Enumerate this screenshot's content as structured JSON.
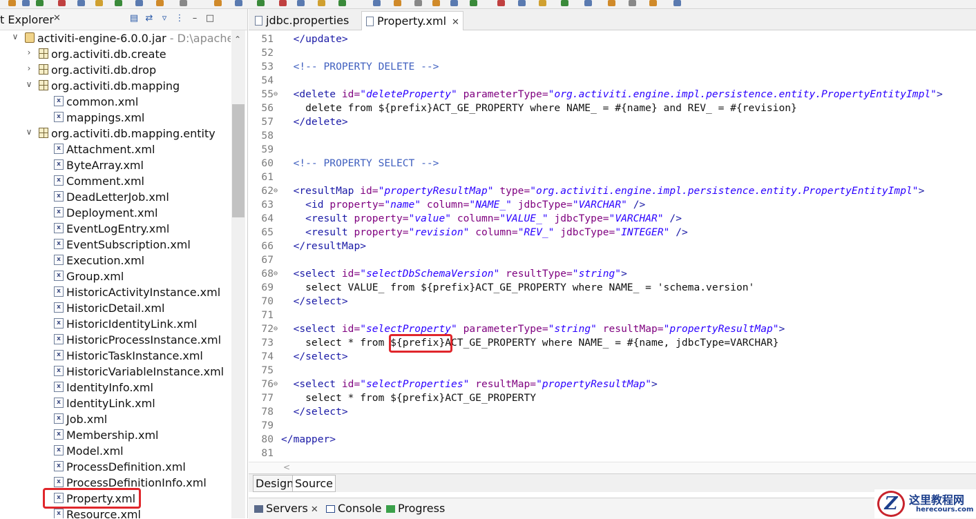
{
  "explorer": {
    "title": "t Explorer",
    "close": "✕",
    "toolbar_icons": [
      "collapse-all-icon",
      "link-editor-icon",
      "filter-icon",
      "view-menu-icon",
      "minimize-icon",
      "maximize-icon"
    ],
    "tree": [
      {
        "label": "activiti-engine-6.0.0.jar",
        "path": "- D:\\apache-ma",
        "type": "jar",
        "arrow": "∨",
        "indent": 0
      },
      {
        "label": "org.activiti.db.create",
        "type": "package",
        "arrow": "›",
        "indent": 1
      },
      {
        "label": "org.activiti.db.drop",
        "type": "package",
        "arrow": "›",
        "indent": 1
      },
      {
        "label": "org.activiti.db.mapping",
        "type": "package",
        "arrow": "∨",
        "indent": 1
      },
      {
        "label": "common.xml",
        "type": "xml",
        "indent": 2
      },
      {
        "label": "mappings.xml",
        "type": "xml",
        "indent": 2
      },
      {
        "label": "org.activiti.db.mapping.entity",
        "type": "package",
        "arrow": "∨",
        "indent": 1
      },
      {
        "label": "Attachment.xml",
        "type": "xml",
        "indent": 2
      },
      {
        "label": "ByteArray.xml",
        "type": "xml",
        "indent": 2
      },
      {
        "label": "Comment.xml",
        "type": "xml",
        "indent": 2
      },
      {
        "label": "DeadLetterJob.xml",
        "type": "xml",
        "indent": 2
      },
      {
        "label": "Deployment.xml",
        "type": "xml",
        "indent": 2
      },
      {
        "label": "EventLogEntry.xml",
        "type": "xml",
        "indent": 2
      },
      {
        "label": "EventSubscription.xml",
        "type": "xml",
        "indent": 2
      },
      {
        "label": "Execution.xml",
        "type": "xml",
        "indent": 2
      },
      {
        "label": "Group.xml",
        "type": "xml",
        "indent": 2
      },
      {
        "label": "HistoricActivityInstance.xml",
        "type": "xml",
        "indent": 2
      },
      {
        "label": "HistoricDetail.xml",
        "type": "xml",
        "indent": 2
      },
      {
        "label": "HistoricIdentityLink.xml",
        "type": "xml",
        "indent": 2
      },
      {
        "label": "HistoricProcessInstance.xml",
        "type": "xml",
        "indent": 2
      },
      {
        "label": "HistoricTaskInstance.xml",
        "type": "xml",
        "indent": 2
      },
      {
        "label": "HistoricVariableInstance.xml",
        "type": "xml",
        "indent": 2
      },
      {
        "label": "IdentityInfo.xml",
        "type": "xml",
        "indent": 2
      },
      {
        "label": "IdentityLink.xml",
        "type": "xml",
        "indent": 2
      },
      {
        "label": "Job.xml",
        "type": "xml",
        "indent": 2
      },
      {
        "label": "Membership.xml",
        "type": "xml",
        "indent": 2
      },
      {
        "label": "Model.xml",
        "type": "xml",
        "indent": 2
      },
      {
        "label": "ProcessDefinition.xml",
        "type": "xml",
        "indent": 2
      },
      {
        "label": "ProcessDefinitionInfo.xml",
        "type": "xml",
        "indent": 2
      },
      {
        "label": "Property.xml",
        "type": "xml",
        "indent": 2,
        "highlighted": true
      },
      {
        "label": "Resource.xml",
        "type": "xml",
        "indent": 2
      }
    ]
  },
  "editor": {
    "tabs": [
      {
        "label": "jdbc.properties",
        "active": false
      },
      {
        "label": "Property.xml",
        "active": true,
        "close": "✕"
      }
    ],
    "lines": [
      {
        "n": "51",
        "parts": [
          [
            "t",
            "  "
          ],
          [
            "tag",
            "</update>"
          ]
        ]
      },
      {
        "n": "52",
        "parts": []
      },
      {
        "n": "53",
        "parts": [
          [
            "t",
            "  "
          ],
          [
            "com",
            "<!-- PROPERTY DELETE -->"
          ]
        ]
      },
      {
        "n": "54",
        "parts": []
      },
      {
        "n": "55",
        "fold": true,
        "parts": [
          [
            "t",
            "  "
          ],
          [
            "tag",
            "<delete "
          ],
          [
            "attr",
            "id="
          ],
          [
            "val",
            "\"deleteProperty\""
          ],
          [
            "t",
            " "
          ],
          [
            "attr",
            "parameterType="
          ],
          [
            "val",
            "\"org.activiti.engine.impl.persistence.entity.PropertyEntityImpl\""
          ],
          [
            "tag",
            ">"
          ]
        ]
      },
      {
        "n": "56",
        "parts": [
          [
            "t",
            "    delete from ${prefix}ACT_GE_PROPERTY where NAME_ = #{name} and REV_ = #{revision}"
          ]
        ]
      },
      {
        "n": "57",
        "parts": [
          [
            "t",
            "  "
          ],
          [
            "tag",
            "</delete>"
          ]
        ]
      },
      {
        "n": "58",
        "parts": []
      },
      {
        "n": "59",
        "parts": []
      },
      {
        "n": "60",
        "parts": [
          [
            "t",
            "  "
          ],
          [
            "com",
            "<!-- PROPERTY SELECT -->"
          ]
        ]
      },
      {
        "n": "61",
        "parts": []
      },
      {
        "n": "62",
        "fold": true,
        "parts": [
          [
            "t",
            "  "
          ],
          [
            "tag",
            "<resultMap "
          ],
          [
            "attr",
            "id="
          ],
          [
            "val",
            "\"propertyResultMap\""
          ],
          [
            "t",
            " "
          ],
          [
            "attr",
            "type="
          ],
          [
            "val",
            "\"org.activiti.engine.impl.persistence.entity.PropertyEntityImpl\""
          ],
          [
            "tag",
            ">"
          ]
        ]
      },
      {
        "n": "63",
        "parts": [
          [
            "t",
            "    "
          ],
          [
            "tag",
            "<id "
          ],
          [
            "attr",
            "property="
          ],
          [
            "val",
            "\"name\""
          ],
          [
            "t",
            " "
          ],
          [
            "attr",
            "column="
          ],
          [
            "val",
            "\"NAME_\""
          ],
          [
            "t",
            " "
          ],
          [
            "attr",
            "jdbcType="
          ],
          [
            "val",
            "\"VARCHAR\""
          ],
          [
            "t",
            " "
          ],
          [
            "tag",
            "/>"
          ]
        ]
      },
      {
        "n": "64",
        "parts": [
          [
            "t",
            "    "
          ],
          [
            "tag",
            "<result "
          ],
          [
            "attr",
            "property="
          ],
          [
            "val",
            "\"value\""
          ],
          [
            "t",
            " "
          ],
          [
            "attr",
            "column="
          ],
          [
            "val",
            "\"VALUE_\""
          ],
          [
            "t",
            " "
          ],
          [
            "attr",
            "jdbcType="
          ],
          [
            "val",
            "\"VARCHAR\""
          ],
          [
            "t",
            " "
          ],
          [
            "tag",
            "/>"
          ]
        ]
      },
      {
        "n": "65",
        "parts": [
          [
            "t",
            "    "
          ],
          [
            "tag",
            "<result "
          ],
          [
            "attr",
            "property="
          ],
          [
            "val",
            "\"revision\""
          ],
          [
            "t",
            " "
          ],
          [
            "attr",
            "column="
          ],
          [
            "val",
            "\"REV_\""
          ],
          [
            "t",
            " "
          ],
          [
            "attr",
            "jdbcType="
          ],
          [
            "val",
            "\"INTEGER\""
          ],
          [
            "t",
            " "
          ],
          [
            "tag",
            "/>"
          ]
        ]
      },
      {
        "n": "66",
        "parts": [
          [
            "t",
            "  "
          ],
          [
            "tag",
            "</resultMap>"
          ]
        ]
      },
      {
        "n": "67",
        "parts": []
      },
      {
        "n": "68",
        "fold": true,
        "parts": [
          [
            "t",
            "  "
          ],
          [
            "tag",
            "<select "
          ],
          [
            "attr",
            "id="
          ],
          [
            "val",
            "\"selectDbSchemaVersion\""
          ],
          [
            "t",
            " "
          ],
          [
            "attr",
            "resultType="
          ],
          [
            "val",
            "\"string\""
          ],
          [
            "tag",
            ">"
          ]
        ]
      },
      {
        "n": "69",
        "parts": [
          [
            "t",
            "    select VALUE_ from ${prefix}ACT_GE_PROPERTY where NAME_ = 'schema.version'"
          ]
        ]
      },
      {
        "n": "70",
        "parts": [
          [
            "t",
            "  "
          ],
          [
            "tag",
            "</select>"
          ]
        ]
      },
      {
        "n": "71",
        "parts": []
      },
      {
        "n": "72",
        "fold": true,
        "parts": [
          [
            "t",
            "  "
          ],
          [
            "tag",
            "<select "
          ],
          [
            "attr",
            "id="
          ],
          [
            "val",
            "\"selectProperty\""
          ],
          [
            "t",
            " "
          ],
          [
            "attr",
            "parameterType="
          ],
          [
            "val",
            "\"string\""
          ],
          [
            "t",
            " "
          ],
          [
            "attr",
            "resultMap="
          ],
          [
            "val",
            "\"propertyResultMap\""
          ],
          [
            "tag",
            ">"
          ]
        ]
      },
      {
        "n": "73",
        "parts": [
          [
            "t",
            "    select * from ${prefix}ACT_GE_PROPERTY where NAME_ = #{name, jdbcType=VARCHAR}"
          ]
        ]
      },
      {
        "n": "74",
        "parts": [
          [
            "t",
            "  "
          ],
          [
            "tag",
            "</select>"
          ]
        ]
      },
      {
        "n": "75",
        "parts": []
      },
      {
        "n": "76",
        "fold": true,
        "parts": [
          [
            "t",
            "  "
          ],
          [
            "tag",
            "<select "
          ],
          [
            "attr",
            "id="
          ],
          [
            "val",
            "\"selectProperties\""
          ],
          [
            "t",
            " "
          ],
          [
            "attr",
            "resultMap="
          ],
          [
            "val",
            "\"propertyResultMap\""
          ],
          [
            "tag",
            ">"
          ]
        ]
      },
      {
        "n": "77",
        "parts": [
          [
            "t",
            "    select * from ${prefix}ACT_GE_PROPERTY"
          ]
        ]
      },
      {
        "n": "78",
        "parts": [
          [
            "t",
            "  "
          ],
          [
            "tag",
            "</select>"
          ]
        ]
      },
      {
        "n": "79",
        "parts": []
      },
      {
        "n": "80",
        "parts": [
          [
            "tag",
            "</mapper>"
          ]
        ]
      },
      {
        "n": "81",
        "parts": []
      }
    ],
    "bottom_tabs": [
      "Design",
      "Source"
    ],
    "hscroll_arrow": "<"
  },
  "views": {
    "tabs": [
      {
        "label": "Servers",
        "close": "✕",
        "icon": "servers-icon"
      },
      {
        "label": "Console",
        "icon": "console-icon"
      },
      {
        "label": "Progress",
        "icon": "progress-icon"
      }
    ]
  },
  "watermark": {
    "logo": "Z",
    "title": "这里教程网",
    "subtitle": "herecours.com"
  },
  "colors": {
    "highlight": "#e0262b",
    "tag": "#1a1aa6",
    "attribute": "#7f007f",
    "value": "#2a00ff",
    "comment": "#3f5fbf"
  }
}
